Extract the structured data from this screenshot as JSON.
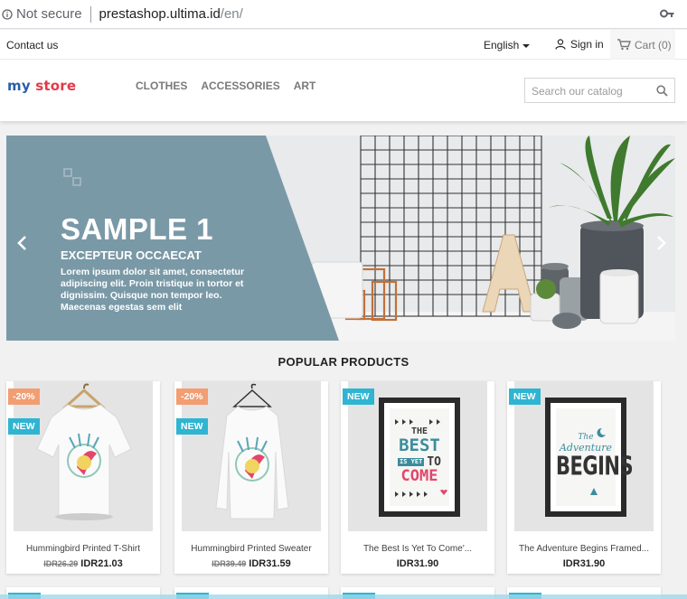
{
  "browser": {
    "security": "Not secure",
    "host": "prestashop.ultima.id",
    "path": "/en/"
  },
  "topnav": {
    "contact": "Contact us",
    "language": "English",
    "signin": "Sign in",
    "cart": "Cart (0)"
  },
  "header": {
    "logo": {
      "word1": "my",
      "word2": "store"
    },
    "menu": [
      "CLOTHES",
      "ACCESSORIES",
      "ART"
    ],
    "search_placeholder": "Search our catalog"
  },
  "slider": {
    "title": "SAMPLE 1",
    "subtitle": "EXCEPTEUR OCCAECAT",
    "description": "Lorem ipsum dolor sit amet, consectetur adipiscing elit. Proin tristique in tortor et dignissim. Quisque non tempor leo. Maecenas egestas sem elit"
  },
  "popular": {
    "title": "POPULAR PRODUCTS",
    "products": [
      {
        "name": "Hummingbird Printed T-Shirt",
        "old_price": "IDR26.29",
        "price": "IDR21.03",
        "discount": "-20%",
        "new": "NEW"
      },
      {
        "name": "Hummingbird Printed Sweater",
        "old_price": "IDR39.49",
        "price": "IDR31.59",
        "discount": "-20%",
        "new": "NEW"
      },
      {
        "name": "The Best Is Yet To Come'...",
        "old_price": "",
        "price": "IDR31.90",
        "discount": "",
        "new": "NEW"
      },
      {
        "name": "The Adventure Begins Framed...",
        "old_price": "",
        "price": "IDR31.90",
        "discount": "",
        "new": "NEW"
      }
    ],
    "poster1": {
      "l1": "THE",
      "l2": "BEST",
      "l3": "IS YET",
      "l4": "TO",
      "l5": "COME"
    },
    "poster2": {
      "l1": "The",
      "l2": "Adventure",
      "l3": "BEGINS"
    }
  },
  "colors": {
    "accent": "#2fb5d2",
    "discount": "#f39d72",
    "slide_panel": "#7a99a7"
  }
}
